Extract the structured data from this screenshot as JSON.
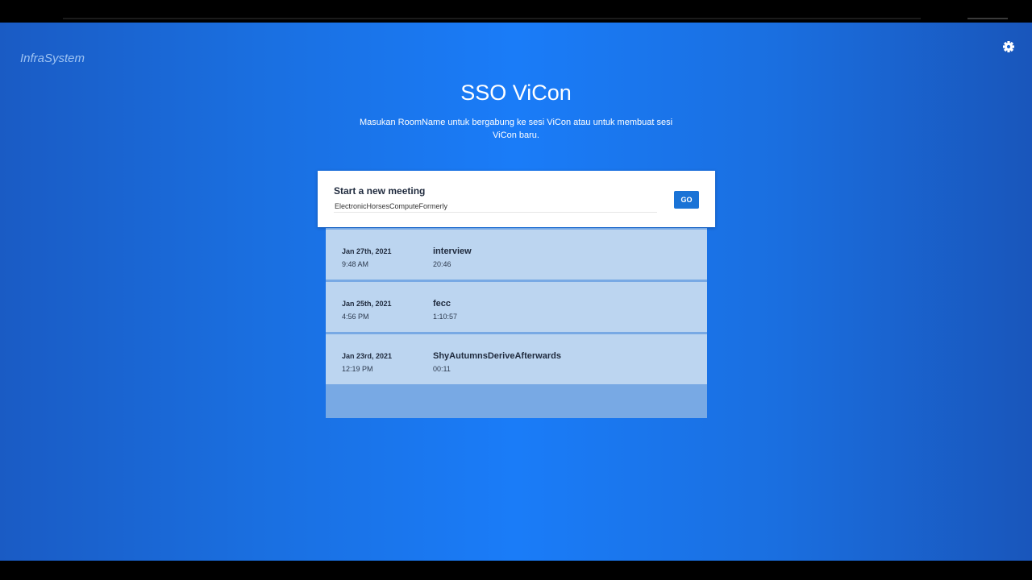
{
  "brand": "InfraSystem",
  "header": {
    "title": "SSO ViCon",
    "subtitle": "Masukan RoomName untuk bergabung ke sesi ViCon atau untuk membuat sesi ViCon baru."
  },
  "meeting_card": {
    "title": "Start a new meeting",
    "room_value": "ElectronicHorsesComputeFormerly",
    "go_label": "GO"
  },
  "history": [
    {
      "date": "Jan 27th, 2021",
      "time": "9:48 AM",
      "name": "interview",
      "duration": "20:46"
    },
    {
      "date": "Jan 25th, 2021",
      "time": "4:56 PM",
      "name": "fecc",
      "duration": "1:10:57"
    },
    {
      "date": "Jan 23rd, 2021",
      "time": "12:19 PM",
      "name": "ShyAutumnsDeriveAfterwards",
      "duration": "00:11"
    }
  ],
  "colors": {
    "background": "#1a7cf8",
    "accent": "#1a73d6",
    "row": "#bcd5f0"
  },
  "icons": {
    "settings": "gear-icon"
  }
}
